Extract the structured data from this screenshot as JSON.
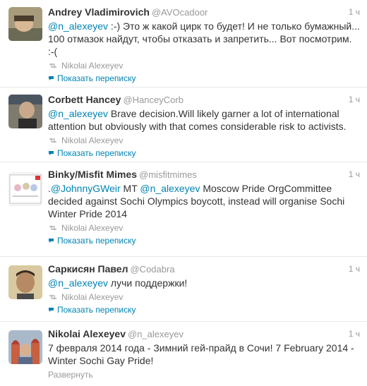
{
  "tweets": [
    {
      "name": "Andrey Vladimirovich",
      "handle": "@AVOcadoor",
      "time": "1 ч",
      "mention": "@n_alexeyev",
      "text": " :-) Это ж какой цирк то будет! И не только бумажный... 100 отмазок найдут, чтобы отказать и запретить... Вот посмотрим. :-(",
      "retweeted_by": "Nikolai Alexeyev",
      "conversation": "Показать переписку"
    },
    {
      "name": "Corbett Hancey",
      "handle": "@HanceyCorb",
      "time": "1 ч",
      "mention": "@n_alexeyev",
      "text": " Brave decision.Will likely garner a lot of international attention but obviously with that comes considerable risk to activists.",
      "retweeted_by": "Nikolai Alexeyev",
      "conversation": "Показать переписку"
    },
    {
      "name": "Binky/Misfit Mimes",
      "handle": "@misfitmimes",
      "time": "1 ч",
      "prefix": ".",
      "mention": "@JohnnyGWeir",
      "mid": " MT ",
      "mention2": "@n_alexeyev",
      "text": " Moscow Pride OrgCommittee decided against Sochi Olympics boycott, instead will organise Sochi Winter Pride 2014",
      "retweeted_by": "Nikolai Alexeyev",
      "conversation": "Показать переписку"
    },
    {
      "name": "Саркисян Павел",
      "handle": "@Codabra",
      "time": "1 ч",
      "mention": "@n_alexeyev",
      "text": " лучи поддержки!",
      "retweeted_by": "Nikolai Alexeyev",
      "conversation": "Показать переписку"
    },
    {
      "name": "Nikolai Alexeyev",
      "handle": "@n_alexeyev",
      "time": "1 ч",
      "text": "7 февраля 2014 года - Зимний гей-прайд в Сочи! 7 February 2014 - Winter Sochi Gay Pride!",
      "expand": "Развернуть"
    }
  ],
  "colors": {
    "link": "#0084b4",
    "muted": "#999999",
    "text": "#333333",
    "divider": "#e8e8e8"
  },
  "icons": {
    "retweet": "retweet-icon",
    "conversation": "speech-bubble-icon"
  }
}
